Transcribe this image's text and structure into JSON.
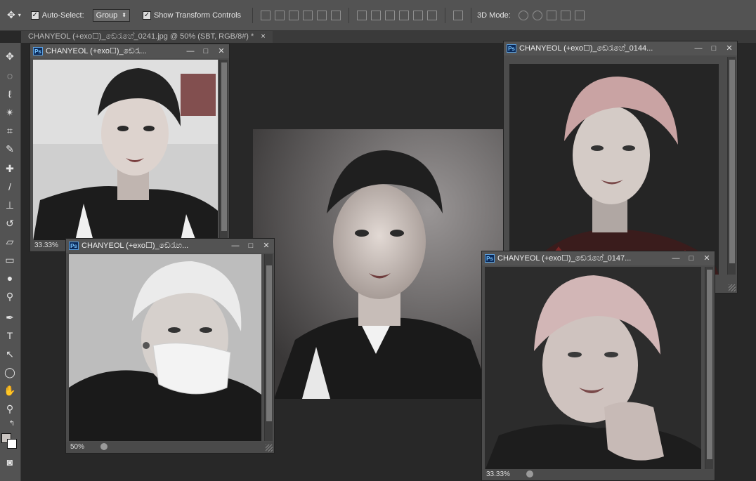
{
  "options_bar": {
    "auto_select_label": "Auto-Select:",
    "auto_select_checked": true,
    "group_value": "Group",
    "show_transform_label": "Show Transform Controls",
    "show_transform_checked": true,
    "mode_3d_label": "3D Mode:"
  },
  "document_tab": {
    "title": "CHANYEOL (+exo☐)_ඞෙරැහේ_0241.jpg @ 50% (SBT, RGB/8#) *",
    "close": "×"
  },
  "windows": [
    {
      "id": "w1",
      "title": "CHANYEOL (+exo☐)_ඞෙරැ...",
      "zoom": "33.33%"
    },
    {
      "id": "w2",
      "title": "CHANYEOL (+exo☐)_ඞෙරැහ...",
      "zoom": "50%"
    },
    {
      "id": "w3",
      "title": "CHANYEOL (+exo☐)_ඞෙරැහේ_0144...",
      "zoom": ""
    },
    {
      "id": "w4",
      "title": "CHANYEOL (+exo☐)_ඞෙරැහේ_0147...",
      "zoom": "33.33%"
    }
  ],
  "window_buttons": {
    "minimize": "—",
    "maximize": "□",
    "close": "✕"
  },
  "badge": "Ps",
  "icons": {
    "tools": [
      "move-icon",
      "marquee-icon",
      "lasso-icon",
      "magic-wand-icon",
      "crop-icon",
      "eyedropper-icon",
      "healing-icon",
      "brush-icon",
      "stamp-icon",
      "history-brush-icon",
      "eraser-icon",
      "gradient-icon",
      "blur-icon",
      "dodge-icon",
      "pen-icon",
      "type-icon",
      "path-select-icon",
      "shape-icon",
      "hand-icon",
      "zoom-icon"
    ]
  },
  "colors": {
    "foreground": "#c9c4c0",
    "background": "#ffffff",
    "accent": "#7ac7ff"
  }
}
